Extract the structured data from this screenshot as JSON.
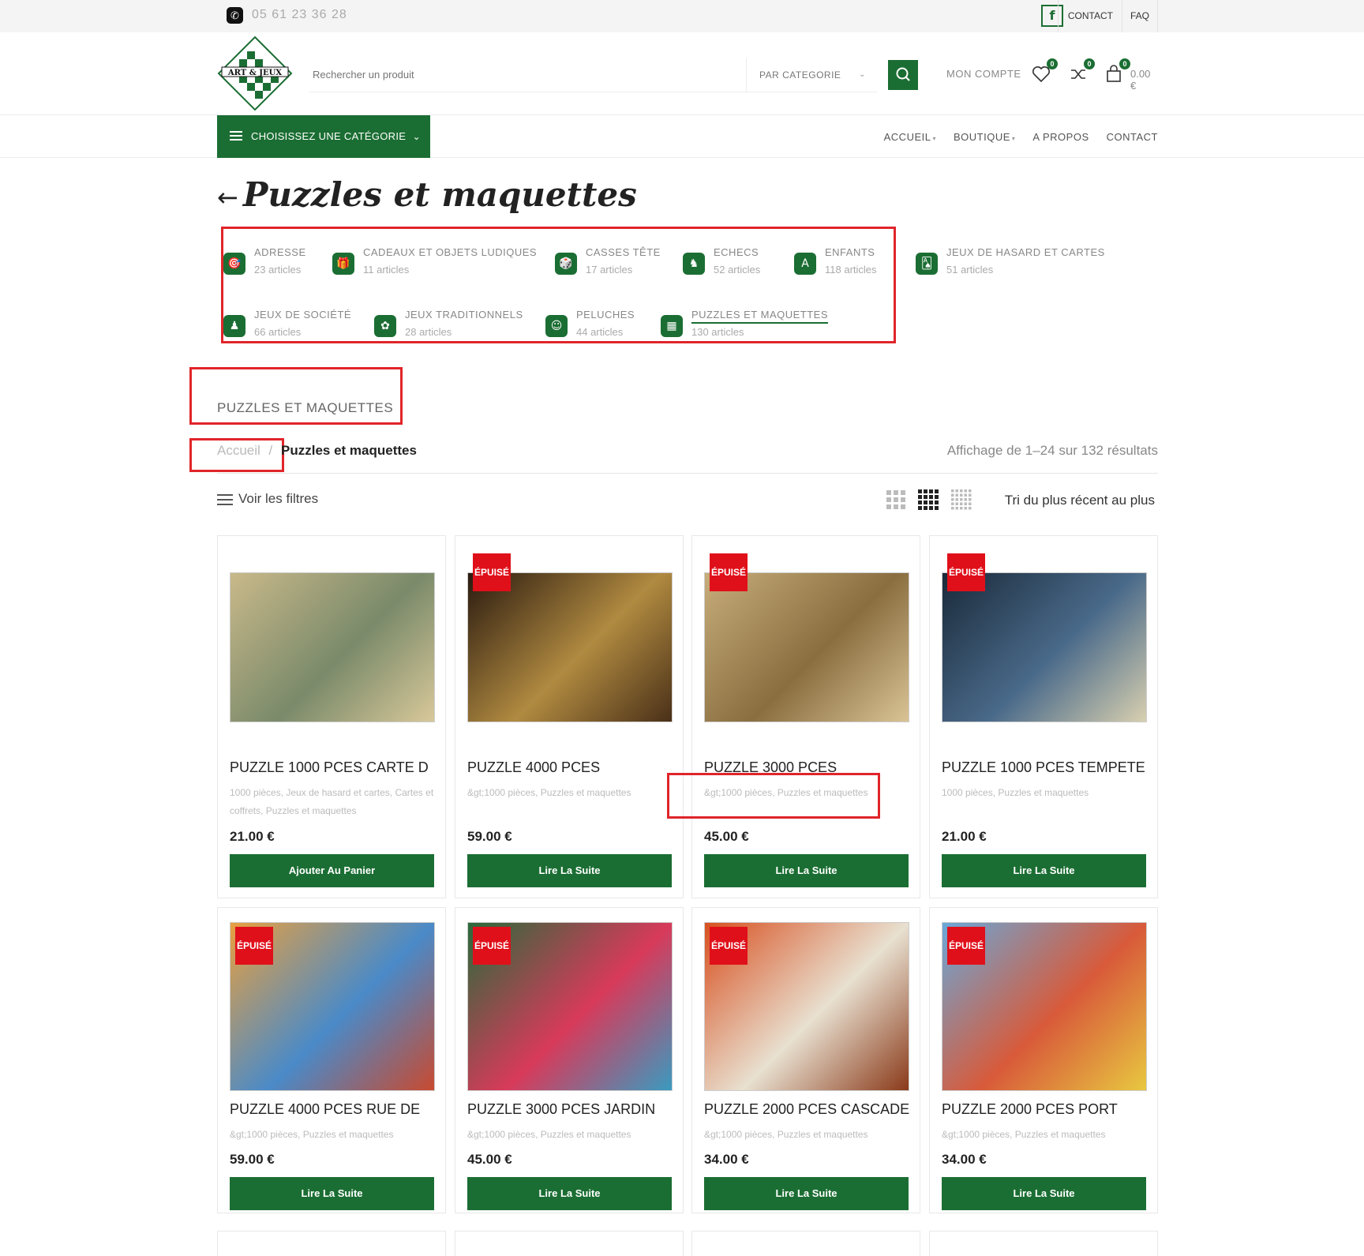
{
  "topbar": {
    "phone": "05 61 23 36 28",
    "facebook_icon": "f",
    "contact": "CONTACT",
    "faq": "FAQ"
  },
  "header": {
    "logo_text": "ART & JEUX",
    "search_placeholder": "Rechercher un produit",
    "search_category": "PAR CATEGORIE",
    "account": "MON COMPTE",
    "wishlist_count": "0",
    "compare_count": "0",
    "cart_count": "0",
    "cart_total": "0.00 €"
  },
  "nav": {
    "category_button": "CHOISISSEZ UNE CATÉGORIE",
    "menu": [
      "ACCUEIL",
      "BOUTIQUE",
      "A PROPOS",
      "CONTACT"
    ]
  },
  "page": {
    "title": "Puzzles et maquettes",
    "heading": "PUZZLES ET MAQUETTES",
    "breadcrumb_home": "Accueil",
    "breadcrumb_sep": "/",
    "breadcrumb_current": "Puzzles et maquettes",
    "results": "Affichage de 1–24 sur 132 résultats",
    "filters": "Voir les filtres",
    "sort": "Tri du plus récent au plus"
  },
  "categories": [
    {
      "name": "ADRESSE",
      "count": "23 articles",
      "icon": "🎯"
    },
    {
      "name": "CADEAUX ET OBJETS LUDIQUES",
      "count": "11 articles",
      "icon": "🎁"
    },
    {
      "name": "CASSES TÊTE",
      "count": "17 articles",
      "icon": "🎲"
    },
    {
      "name": "ECHECS",
      "count": "52 articles",
      "icon": "♞"
    },
    {
      "name": "ENFANTS",
      "count": "118 articles",
      "icon": "A"
    },
    {
      "name": "JEUX DE HASARD ET CARTES",
      "count": "51 articles",
      "icon": "🂡"
    },
    {
      "name": "JEUX DE SOCIÉTÉ",
      "count": "66 articles",
      "icon": "♟"
    },
    {
      "name": "JEUX TRADITIONNELS",
      "count": "28 articles",
      "icon": "✿"
    },
    {
      "name": "PELUCHES",
      "count": "44 articles",
      "icon": "☺"
    },
    {
      "name": "PUZZLES ET MAQUETTES",
      "count": "130 articles",
      "icon": "▦"
    }
  ],
  "badge_label": "ÉPUISÉ",
  "products": [
    {
      "title": "PUZZLE 1000 PCES CARTE D",
      "cats": "1000 pièces, Jeux de hasard et cartes, Cartes et coffrets, Puzzles et maquettes",
      "price": "21.00 €",
      "button": "Ajouter Au Panier",
      "soldout": false,
      "colors": [
        "#c9b98a",
        "#7a8a6a",
        "#d8c89a"
      ]
    },
    {
      "title": "PUZZLE 4000 PCES",
      "cats": "&gt;1000 pièces, Puzzles et maquettes",
      "price": "59.00 €",
      "button": "Lire La Suite",
      "soldout": true,
      "colors": [
        "#2a1a10",
        "#b08a40",
        "#4a3018"
      ]
    },
    {
      "title": "PUZZLE 3000 PCES",
      "cats": "&gt;1000 pièces, Puzzles et maquettes",
      "price": "45.00 €",
      "button": "Lire La Suite",
      "soldout": true,
      "colors": [
        "#c7ad7a",
        "#8a6e40",
        "#d9c394"
      ]
    },
    {
      "title": "PUZZLE 1000 PCES TEMPETE",
      "cats": "1000 pièces, Puzzles et maquettes",
      "price": "21.00 €",
      "button": "Lire La Suite",
      "soldout": true,
      "colors": [
        "#1a2a3a",
        "#4a6a8a",
        "#d8d0b0"
      ]
    },
    {
      "title": "PUZZLE 4000 PCES RUE DE",
      "cats": "&gt;1000 pièces, Puzzles et maquettes",
      "price": "59.00 €",
      "button": "Lire La Suite",
      "soldout": true,
      "colors": [
        "#e8a040",
        "#4a8ac8",
        "#c84a30"
      ]
    },
    {
      "title": "PUZZLE 3000 PCES JARDIN",
      "cats": "&gt;1000 pièces, Puzzles et maquettes",
      "price": "45.00 €",
      "button": "Lire La Suite",
      "soldout": true,
      "colors": [
        "#2a6a3a",
        "#d83a5a",
        "#3a9ac0"
      ]
    },
    {
      "title": "PUZZLE 2000 PCES CASCADE",
      "cats": "&gt;1000 pièces, Puzzles et maquettes",
      "price": "34.00 €",
      "button": "Lire La Suite",
      "soldout": true,
      "colors": [
        "#d85020",
        "#e8e0d0",
        "#8a3a1a"
      ]
    },
    {
      "title": "PUZZLE 2000 PCES PORT",
      "cats": "&gt;1000 pièces, Puzzles et maquettes",
      "price": "34.00 €",
      "button": "Lire La Suite",
      "soldout": true,
      "colors": [
        "#6aa8d8",
        "#d85a3a",
        "#e8c840"
      ]
    }
  ],
  "accent": "#1b6e33",
  "badge_color": "#e0101a"
}
